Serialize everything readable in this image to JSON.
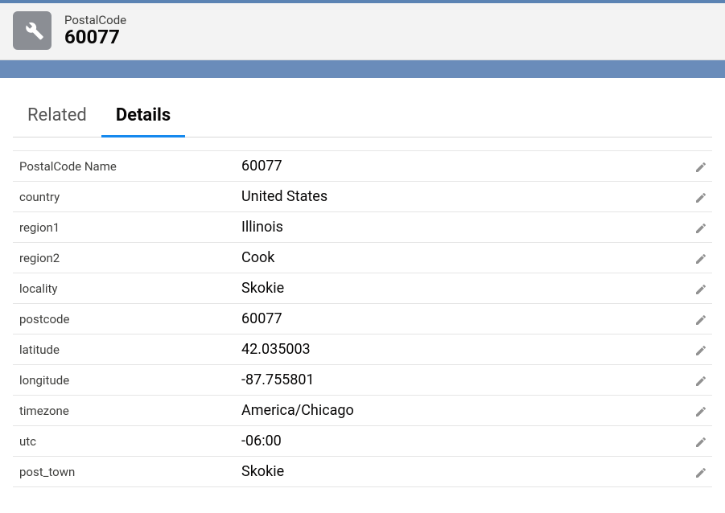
{
  "header": {
    "object_label": "PostalCode",
    "title": "60077"
  },
  "tabs": {
    "related": "Related",
    "details": "Details"
  },
  "fields": {
    "postalcode_name": {
      "label": "PostalCode Name",
      "value": "60077"
    },
    "country": {
      "label": "country",
      "value": "United States"
    },
    "region1": {
      "label": "region1",
      "value": "Illinois"
    },
    "region2": {
      "label": "region2",
      "value": "Cook"
    },
    "locality": {
      "label": "locality",
      "value": "Skokie"
    },
    "postcode": {
      "label": "postcode",
      "value": "60077"
    },
    "latitude": {
      "label": "latitude",
      "value": "42.035003"
    },
    "longitude": {
      "label": "longitude",
      "value": "-87.755801"
    },
    "timezone": {
      "label": "timezone",
      "value": "America/Chicago"
    },
    "utc": {
      "label": "utc",
      "value": "-06:00"
    },
    "post_town": {
      "label": "post_town",
      "value": "Skokie"
    }
  }
}
